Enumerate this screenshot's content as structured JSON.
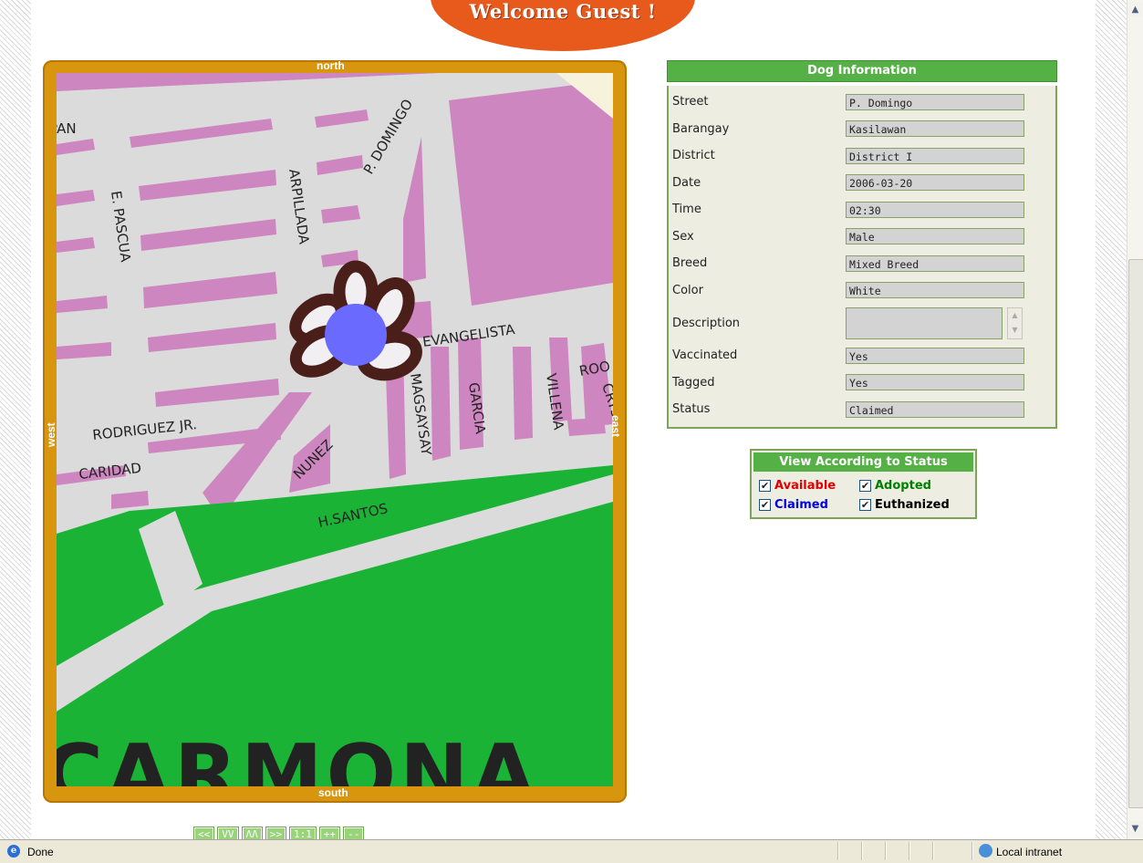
{
  "banner": {
    "welcome": "Welcome Guest !"
  },
  "map": {
    "compass": {
      "north": "north",
      "south": "south",
      "west": "west",
      "east": "east"
    },
    "streets": [
      "P. DOMINGO",
      "ARPILLADA",
      "E. PASCUA",
      "PAN",
      "EVANGELISTA",
      "MAGSAYSAY",
      "GARCIA",
      "VILLENA",
      "ROO",
      "CRYSTAL",
      "RODRIGUEZ JR.",
      "CARIDAD",
      "NUNEZ",
      "H.SANTOS",
      "CARMONA"
    ],
    "marker_icon": "paw-marker-icon",
    "controls": [
      "<<",
      "VV",
      "ΛΛ",
      ">>",
      "1:1",
      "++",
      "--"
    ]
  },
  "dog_info": {
    "title": "Dog Information",
    "fields": [
      {
        "label": "Street",
        "value": "P. Domingo"
      },
      {
        "label": "Barangay",
        "value": "Kasilawan"
      },
      {
        "label": "District",
        "value": "District I"
      },
      {
        "label": "Date",
        "value": "2006-03-20"
      },
      {
        "label": "Time",
        "value": "02:30"
      },
      {
        "label": "Sex",
        "value": "Male"
      },
      {
        "label": "Breed",
        "value": "Mixed Breed"
      },
      {
        "label": "Color",
        "value": "White"
      },
      {
        "label": "Description",
        "value": ""
      },
      {
        "label": "Vaccinated",
        "value": "Yes"
      },
      {
        "label": "Tagged",
        "value": "Yes"
      },
      {
        "label": "Status",
        "value": "Claimed"
      }
    ]
  },
  "status_filter": {
    "title": "View According to Status",
    "options": [
      {
        "label": "Available",
        "checked": true,
        "color": "#e00000"
      },
      {
        "label": "Adopted",
        "checked": true,
        "color": "#008000"
      },
      {
        "label": "Claimed",
        "checked": true,
        "color": "#0000e0"
      },
      {
        "label": "Euthanized",
        "checked": true,
        "color": "#000000"
      }
    ]
  },
  "statusbar": {
    "status": "Done",
    "zone": "Local intranet"
  },
  "colors": {
    "accent": "#55b046",
    "map_frame": "#d8960e",
    "banner": "#e85a1c",
    "marker": "#6a6aff"
  }
}
